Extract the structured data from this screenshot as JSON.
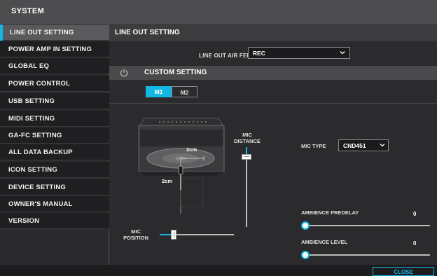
{
  "window": {
    "title": "SYSTEM"
  },
  "sidebar": {
    "active_index": 0,
    "items": [
      {
        "label": "LINE OUT SETTING"
      },
      {
        "label": "POWER AMP IN SETTING"
      },
      {
        "label": "GLOBAL EQ"
      },
      {
        "label": "POWER CONTROL"
      },
      {
        "label": "USB SETTING"
      },
      {
        "label": "MIDI SETTING"
      },
      {
        "label": "GA-FC SETTING"
      },
      {
        "label": "ALL DATA BACKUP"
      },
      {
        "label": "ICON SETTING"
      },
      {
        "label": "DEVICE SETTING"
      },
      {
        "label": "OWNER'S MANUAL"
      },
      {
        "label": "VERSION"
      }
    ]
  },
  "main": {
    "section_title": "LINE OUT SETTING",
    "line_out_air_feel": {
      "label": "LINE OUT AIR FEEL",
      "value": "REC"
    },
    "custom_setting": {
      "label": "CUSTOM SETTING"
    },
    "tabs": [
      {
        "label": "M1",
        "selected": true
      },
      {
        "label": "M2",
        "selected": false
      }
    ],
    "diagram": {
      "distance_label_top": "2cm",
      "distance_label_side": "2cm"
    },
    "mic_distance": {
      "label_line1": "MIC",
      "label_line2": "DISTANCE"
    },
    "mic_position": {
      "label_line1": "MIC",
      "label_line2": "POSITION"
    },
    "mic_type": {
      "label": "MIC TYPE",
      "value": "CND451"
    },
    "ambience_predelay": {
      "label": "AMBIENCE PREDELAY",
      "value": "0"
    },
    "ambience_level": {
      "label": "AMBIENCE LEVEL",
      "value": "0"
    }
  },
  "footer": {
    "close_label": "CLOSE"
  },
  "colors": {
    "accent": "#12b7e3",
    "titlebar": "#4d4d4f",
    "panel": "#2b2b2d"
  }
}
